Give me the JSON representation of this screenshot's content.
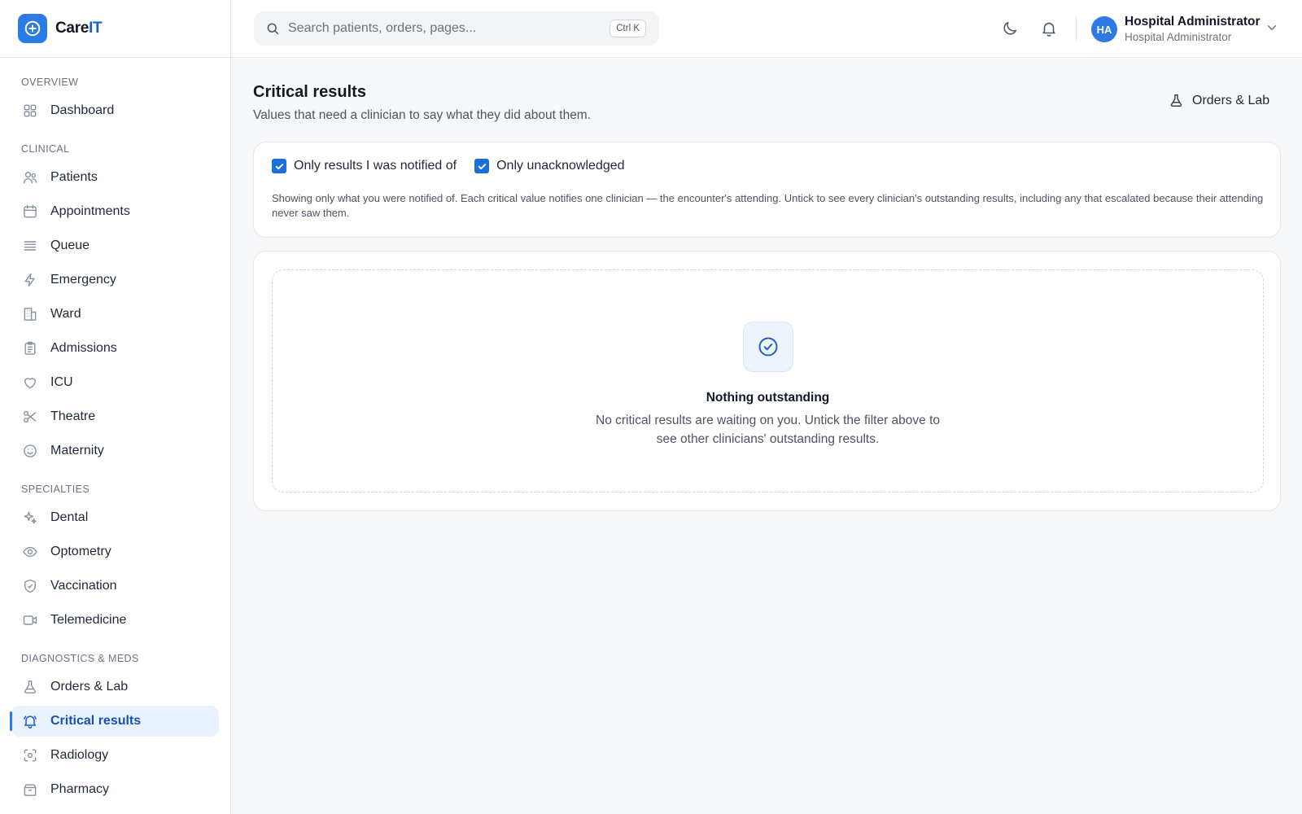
{
  "brand": {
    "name_main": "Care",
    "name_accent": "IT"
  },
  "search": {
    "placeholder": "Search patients, orders, pages...",
    "shortcut": "Ctrl K"
  },
  "user": {
    "initials": "HA",
    "name": "Hospital Administrator",
    "role": "Hospital Administrator"
  },
  "sidebar": {
    "sections": [
      {
        "title": "OVERVIEW",
        "items": [
          {
            "label": "Dashboard",
            "icon": "grid-icon"
          }
        ]
      },
      {
        "title": "CLINICAL",
        "items": [
          {
            "label": "Patients",
            "icon": "users-icon"
          },
          {
            "label": "Appointments",
            "icon": "calendar-icon"
          },
          {
            "label": "Queue",
            "icon": "list-icon"
          },
          {
            "label": "Emergency",
            "icon": "lightning-icon"
          },
          {
            "label": "Ward",
            "icon": "building-icon"
          },
          {
            "label": "Admissions",
            "icon": "clipboard-icon"
          },
          {
            "label": "ICU",
            "icon": "heart-icon"
          },
          {
            "label": "Theatre",
            "icon": "scissors-icon"
          },
          {
            "label": "Maternity",
            "icon": "smile-icon"
          }
        ]
      },
      {
        "title": "SPECIALTIES",
        "items": [
          {
            "label": "Dental",
            "icon": "sparkles-icon"
          },
          {
            "label": "Optometry",
            "icon": "eye-icon"
          },
          {
            "label": "Vaccination",
            "icon": "shield-check-icon"
          },
          {
            "label": "Telemedicine",
            "icon": "video-icon"
          }
        ]
      },
      {
        "title": "DIAGNOSTICS & MEDS",
        "items": [
          {
            "label": "Orders & Lab",
            "icon": "flask-icon"
          },
          {
            "label": "Critical results",
            "icon": "bell-ring-icon",
            "active": true
          },
          {
            "label": "Radiology",
            "icon": "scan-icon"
          },
          {
            "label": "Pharmacy",
            "icon": "pill-box-icon"
          }
        ]
      }
    ]
  },
  "page": {
    "title": "Critical results",
    "subtitle": "Values that need a clinician to say what they did about them.",
    "header_link": "Orders & Lab"
  },
  "filters": {
    "notified_label": "Only results I was notified of",
    "notified_checked": true,
    "unacknowledged_label": "Only unacknowledged",
    "unacknowledged_checked": true,
    "note": "Showing only what you were notified of. Each critical value notifies one clinician — the encounter's attending. Untick to see every clinician's outstanding results, including any that escalated because their attending never saw them."
  },
  "empty_state": {
    "title": "Nothing outstanding",
    "text": "No critical results are waiting on you. Untick the filter above to see other clinicians' outstanding results."
  },
  "colors": {
    "accent": "#2c7be5",
    "active_bg": "#eaf2fd",
    "active_text": "#1550b4"
  }
}
